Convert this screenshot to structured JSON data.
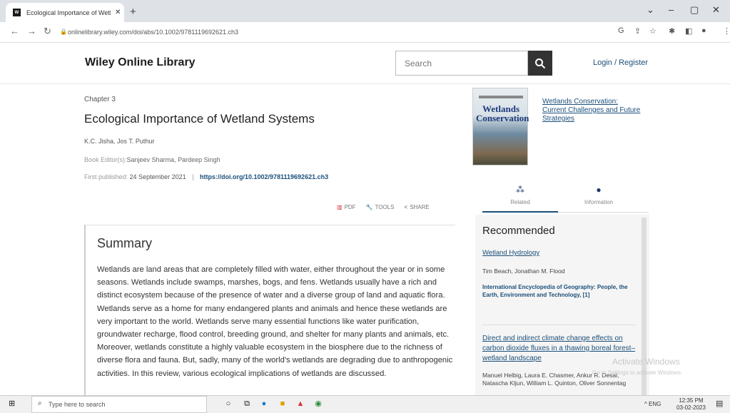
{
  "browser": {
    "tab_title": "Ecological Importance of Wetlan",
    "tab_close": "✕",
    "new_tab": "+",
    "tab_favicon": "W",
    "url": "onlinelibrary.wiley.com/doi/abs/10.1002/9781119692621.ch3",
    "window_controls": [
      "⌄",
      "–",
      "▢",
      "✕"
    ]
  },
  "header": {
    "logo": "Wiley Online Library",
    "search_placeholder": "Search",
    "login": "Login / Register"
  },
  "article": {
    "chapter_label": "Chapter 3",
    "title": "Ecological Importance of Wetland Systems",
    "authors": "K.C. Jisha, Jos T. Puthur",
    "editors_label": "Book Editor(s):",
    "editors": "Sanjeev Sharma, Pardeep Singh",
    "published_label": "First published:",
    "published_date": "24 September 2021",
    "separator": "|",
    "doi": "https://doi.org/10.1002/9781119692621.ch3",
    "tools": {
      "pdf": "PDF",
      "tools": "TOOLS",
      "share": "SHARE"
    },
    "summary_title": "Summary",
    "summary_text": "Wetlands are land areas that are completely filled with water, either throughout the year or in some seasons. Wetlands include swamps, marshes, bogs, and fens. Wetlands usually have a rich and distinct ecosystem because of the presence of water and a diverse group of land and aquatic flora. Wetlands serve as a home for many endangered plants and animals and hence these wetlands are very important to the world. Wetlands serve many essential functions like water purification, groundwater recharge, flood control, breeding ground, and shelter for many plants and animals, etc. Moreover, wetlands constitute a highly valuable ecosystem in the biosphere due to the richness of diverse flora and fauna. But, sadly, many of the world's wetlands are degrading due to anthropogenic activities. In this review, various ecological implications of wetlands are discussed."
  },
  "sidebar": {
    "book_title": "Wetlands Conservation: Current Challenges and Future Strategies",
    "cover_text": "Wetlands Conservation",
    "tabs": [
      {
        "label": "Related",
        "icon": "related-icon"
      },
      {
        "label": "Information",
        "icon": "info-icon"
      }
    ],
    "recommended_heading": "Recommended",
    "recommended": [
      {
        "title": "Wetland Hydrology",
        "authors": "Tim Beach, Jonathan M. Flood",
        "source": "International Encyclopedia of Geography: People, the Earth, Environment and Technology, [1]"
      },
      {
        "title": "Direct and indirect climate change effects on carbon dioxide fluxes in a thawing boreal forest–wetland landscape",
        "authors": "Manuel Helbig, Laura E. Chasmer, Ankur R. Desai, Natascha Kljun, William L. Quinton, Oliver Sonnentag"
      }
    ]
  },
  "watermark": {
    "line1": "Activate Windows",
    "line2": "Go to Settings to activate Windows."
  },
  "taskbar": {
    "search_placeholder": "Type here to search",
    "tray": "^ ENG",
    "time": "12:35 PM",
    "date": "03-02-2023"
  }
}
